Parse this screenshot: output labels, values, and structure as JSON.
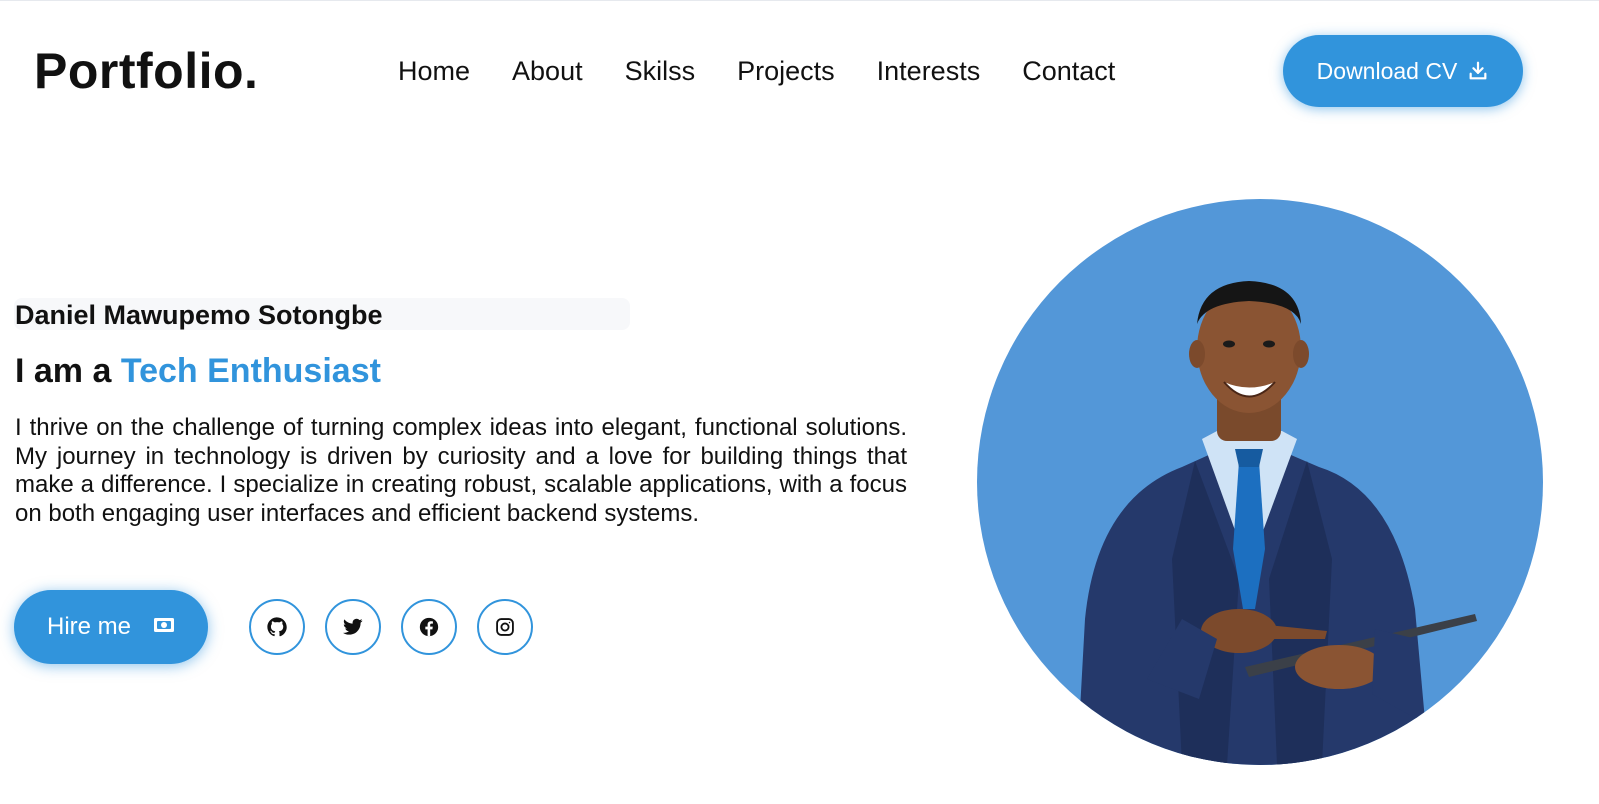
{
  "header": {
    "logo": "Portfolio.",
    "nav": [
      "Home",
      "About",
      "Skilss",
      "Projects",
      "Interests",
      "Contact"
    ],
    "download_label": "Download CV",
    "download_icon": "download-icon"
  },
  "hero": {
    "name": "Daniel Mawupemo Sotongbe",
    "headline_prefix": "I am a",
    "headline_accent": "Tech Enthusiast",
    "bio": "I thrive on the challenge of turning complex ideas into elegant, functional solutions. My journey in technology is driven by curiosity and a love for building things that make a difference. I specialize in creating robust, scalable applications, with a focus on both engaging user interfaces and efficient backend systems.",
    "hire_label": "Hire me",
    "hire_icon": "money-icon",
    "socials": [
      "github-icon",
      "twitter-icon",
      "facebook-icon",
      "instagram-icon"
    ],
    "photo": "profile-photo"
  },
  "colors": {
    "accent": "#3194dc",
    "circle": "#5397d8",
    "text": "#111111"
  }
}
